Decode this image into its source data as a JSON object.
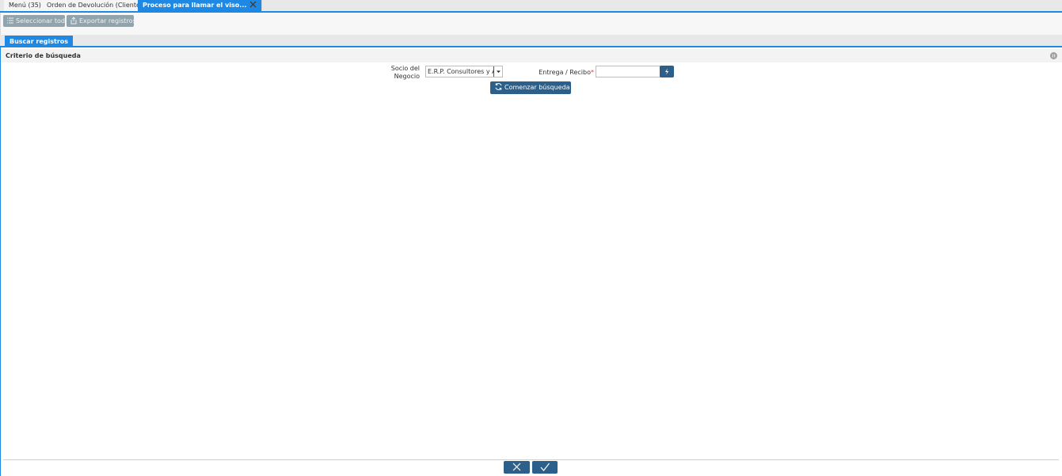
{
  "tabs": [
    {
      "label": "Menú (35)",
      "closable": false
    },
    {
      "label": "Orden de Devolución (Cliente)",
      "closable": true
    },
    {
      "label": "Proceso para llamar el viso...",
      "closable": true,
      "active": true
    }
  ],
  "toolbar": {
    "select_all": "Seleccionar todo",
    "export": "Exportar registros"
  },
  "subtab": {
    "label": "Buscar registros"
  },
  "criteria": {
    "title": "Criterio de búsqueda"
  },
  "form": {
    "partner_label": "Socio del Negocio",
    "partner_value": "E.R.P. Consultores y Asociados",
    "shipment_label": "Entrega / Recibo",
    "shipment_required_mark": "*",
    "shipment_value": ""
  },
  "search_button": "Comenzar búsqueda ...",
  "colors": {
    "accent": "#1e88e5",
    "button_dark": "#2c5f8a",
    "button_disabled": "#90a4ae",
    "required": "#e53935"
  },
  "icons": {
    "select_all": "list-icon",
    "export": "export-icon",
    "lookup": "lightning-icon",
    "refresh": "refresh-icon",
    "cancel": "close-icon",
    "ok": "check-icon"
  }
}
